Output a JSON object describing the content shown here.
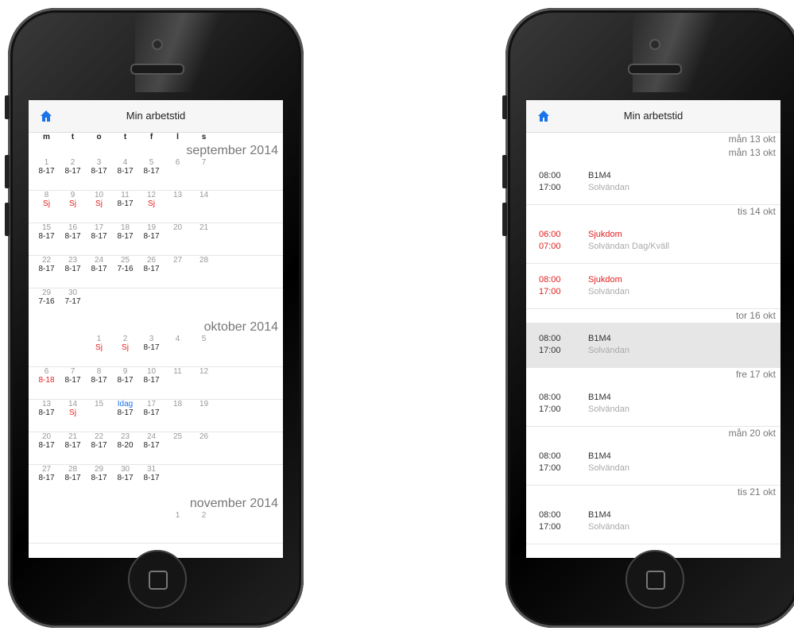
{
  "left_phone": {
    "title": "Min arbetstid",
    "days_of_week": [
      "m",
      "t",
      "o",
      "t",
      "f",
      "l",
      "s"
    ],
    "months": [
      {
        "label": "september 2014",
        "weeks": [
          [
            [
              "1",
              "8-17"
            ],
            [
              "2",
              "8-17"
            ],
            [
              "3",
              "8-17"
            ],
            [
              "4",
              "8-17"
            ],
            [
              "5",
              "8-17"
            ],
            [
              "6",
              ""
            ],
            [
              "7",
              ""
            ]
          ],
          [
            [
              "8",
              "Sj"
            ],
            [
              "9",
              "Sj"
            ],
            [
              "10",
              "Sj"
            ],
            [
              "11",
              "8-17"
            ],
            [
              "12",
              "Sj"
            ],
            [
              "13",
              ""
            ],
            [
              "14",
              ""
            ]
          ],
          [
            [
              "15",
              "8-17"
            ],
            [
              "16",
              "8-17"
            ],
            [
              "17",
              "8-17"
            ],
            [
              "18",
              "8-17"
            ],
            [
              "19",
              "8-17"
            ],
            [
              "20",
              ""
            ],
            [
              "21",
              ""
            ]
          ],
          [
            [
              "22",
              "8-17"
            ],
            [
              "23",
              "8-17"
            ],
            [
              "24",
              "8-17"
            ],
            [
              "25",
              "7-16"
            ],
            [
              "26",
              "8-17"
            ],
            [
              "27",
              ""
            ],
            [
              "28",
              ""
            ]
          ],
          [
            [
              "29",
              "7-16"
            ],
            [
              "30",
              "7-17"
            ]
          ]
        ]
      },
      {
        "label": "oktober 2014",
        "weeks": [
          [
            [
              "",
              ""
            ],
            [
              "",
              ""
            ],
            [
              "1",
              "Sj"
            ],
            [
              "2",
              "Sj"
            ],
            [
              "3",
              "8-17"
            ],
            [
              "4",
              ""
            ],
            [
              "5",
              ""
            ]
          ],
          [
            [
              "6",
              "8-18"
            ],
            [
              "7",
              "8-17"
            ],
            [
              "8",
              "8-17"
            ],
            [
              "9",
              "8-17"
            ],
            [
              "10",
              "8-17"
            ],
            [
              "11",
              ""
            ],
            [
              "12",
              ""
            ]
          ],
          [
            [
              "13",
              "8-17"
            ],
            [
              "14",
              "Sj"
            ],
            [
              "15",
              ""
            ],
            [
              "Idag",
              "8-17"
            ],
            [
              "17",
              "8-17"
            ],
            [
              "18",
              ""
            ],
            [
              "19",
              ""
            ]
          ],
          [
            [
              "20",
              "8-17"
            ],
            [
              "21",
              "8-17"
            ],
            [
              "22",
              "8-17"
            ],
            [
              "23",
              "8-20"
            ],
            [
              "24",
              "8-17"
            ],
            [
              "25",
              ""
            ],
            [
              "26",
              ""
            ]
          ],
          [
            [
              "27",
              "8-17"
            ],
            [
              "28",
              "8-17"
            ],
            [
              "29",
              "8-17"
            ],
            [
              "30",
              "8-17"
            ],
            [
              "31",
              "8-17"
            ]
          ]
        ]
      },
      {
        "label": "november 2014",
        "weeks": [
          [
            [
              "",
              ""
            ],
            [
              "",
              ""
            ],
            [
              "",
              ""
            ],
            [
              "",
              ""
            ],
            [
              "",
              ""
            ],
            [
              "1",
              ""
            ],
            [
              "2",
              ""
            ]
          ]
        ]
      }
    ]
  },
  "right_phone": {
    "title": "Min arbetstid",
    "entries": [
      {
        "heads": [
          "mån 13 okt",
          "mån 13 okt"
        ],
        "start": "08:00",
        "end": "17:00",
        "code": "B1M4",
        "place": "Solvändan",
        "alert": false,
        "highlight": false
      },
      {
        "heads": [
          "tis 14 okt"
        ],
        "start": "06:00",
        "end": "07:00",
        "code": "Sjukdom",
        "place": "Solvändan Dag/Kväll",
        "alert": true,
        "highlight": false
      },
      {
        "heads": [],
        "start": "08:00",
        "end": "17:00",
        "code": "Sjukdom",
        "place": "Solvändan",
        "alert": true,
        "highlight": false
      },
      {
        "heads": [
          "tor 16 okt"
        ],
        "start": "08:00",
        "end": "17:00",
        "code": "B1M4",
        "place": "Solvändan",
        "alert": false,
        "highlight": true
      },
      {
        "heads": [
          "fre 17 okt"
        ],
        "start": "08:00",
        "end": "17:00",
        "code": "B1M4",
        "place": "Solvändan",
        "alert": false,
        "highlight": false
      },
      {
        "heads": [
          "mån 20 okt"
        ],
        "start": "08:00",
        "end": "17:00",
        "code": "B1M4",
        "place": "Solvändan",
        "alert": false,
        "highlight": false
      },
      {
        "heads": [
          "tis 21 okt"
        ],
        "start": "08:00",
        "end": "17:00",
        "code": "B1M4",
        "place": "Solvändan",
        "alert": false,
        "highlight": false
      }
    ]
  },
  "colors": {
    "accent": "#1a73e8",
    "alert": "#e02020",
    "muted": "#999999"
  }
}
